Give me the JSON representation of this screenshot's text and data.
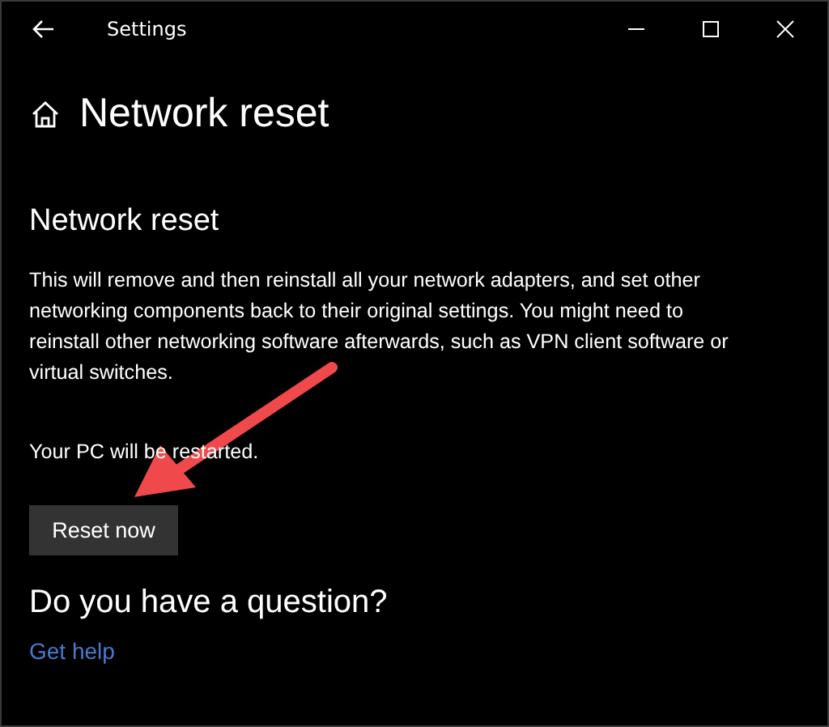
{
  "window": {
    "title": "Settings"
  },
  "page_title": "Network reset",
  "section": {
    "heading": "Network reset",
    "description": "This will remove and then reinstall all your network adapters, and set other networking components back to their original settings. You might need to reinstall other networking software afterwards, such as VPN client software or virtual switches.",
    "note": "Your PC will be restarted.",
    "button": "Reset now"
  },
  "help": {
    "heading": "Do you have a question?",
    "link": "Get help"
  }
}
